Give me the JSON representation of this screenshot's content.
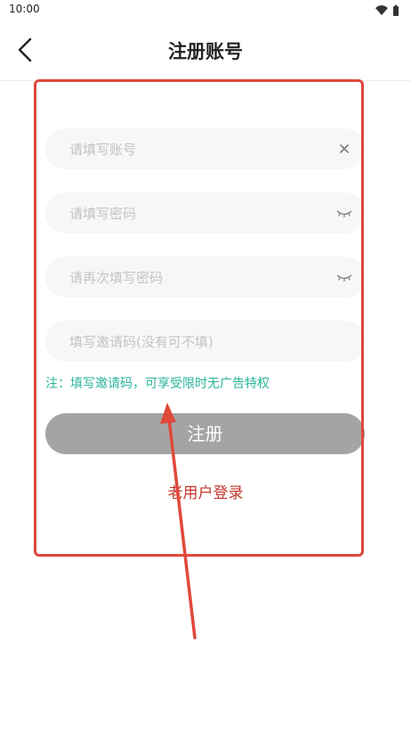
{
  "status_bar": {
    "time": "10:00",
    "icons": [
      "wifi-icon",
      "battery-icon"
    ]
  },
  "header": {
    "title": "注册账号",
    "back_icon": "chevron-left-icon"
  },
  "form": {
    "account_placeholder": "请填写账号",
    "password_placeholder": "请填写密码",
    "confirm_password_placeholder": "请再次填写密码",
    "invite_code_placeholder": "填写邀请码(没有可不填)",
    "note": "注：填写邀请码，可享受限时无广告特权",
    "register_label": "注册",
    "login_link": "老用户登录"
  },
  "colors": {
    "accent_green": "#2bb39a",
    "login_red": "#c0362c",
    "button_gray": "#a4a4a4",
    "annotation_red": "#e0483a"
  }
}
